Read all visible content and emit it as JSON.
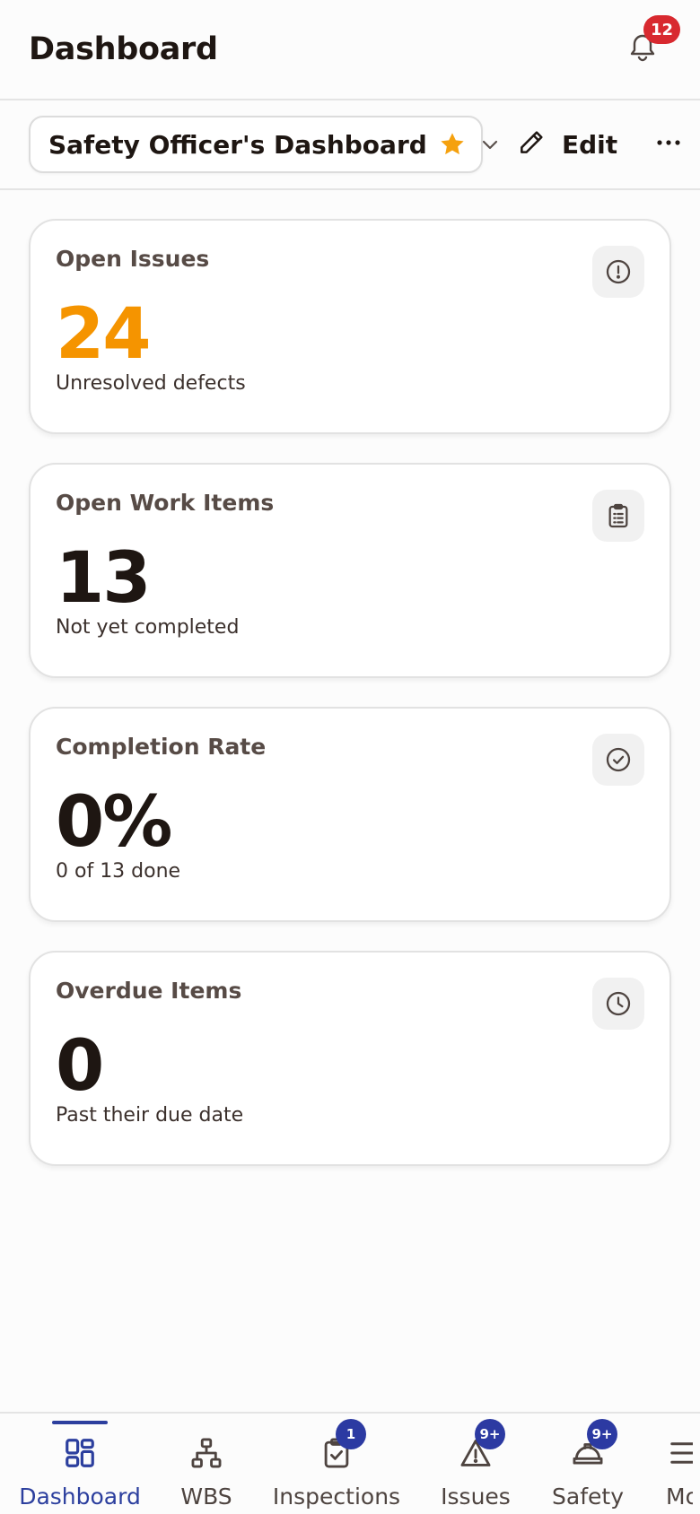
{
  "header": {
    "title": "Dashboard",
    "notification_count": "12"
  },
  "toolbar": {
    "dashboard_name": "Safety Officer's Dashboard",
    "edit_label": "Edit"
  },
  "cards": [
    {
      "title": "Open Issues",
      "value": "24",
      "subtitle": "Unresolved defects",
      "icon": "alert-circle-icon",
      "value_color": "#f59400"
    },
    {
      "title": "Open Work Items",
      "value": "13",
      "subtitle": "Not yet completed",
      "icon": "clipboard-list-icon"
    },
    {
      "title": "Completion Rate",
      "value": "0%",
      "subtitle": "0 of 13 done",
      "icon": "check-circle-icon"
    },
    {
      "title": "Overdue Items",
      "value": "0",
      "subtitle": "Past their due date",
      "icon": "clock-icon"
    }
  ],
  "nav": {
    "items": [
      {
        "label": "Dashboard",
        "icon": "dashboard-grid-icon",
        "active": true
      },
      {
        "label": "WBS",
        "icon": "hierarchy-icon"
      },
      {
        "label": "Inspections",
        "icon": "clipboard-check-icon",
        "badge": "1"
      },
      {
        "label": "Issues",
        "icon": "warning-triangle-icon",
        "badge": "9+"
      },
      {
        "label": "Safety",
        "icon": "hard-hat-icon",
        "badge": "9+"
      },
      {
        "label": "More",
        "icon": "menu-icon"
      }
    ]
  },
  "colors": {
    "accent": "#2c3f9e",
    "warning": "#f59400",
    "alert_badge": "#d8292f",
    "star": "#f5a10f"
  }
}
